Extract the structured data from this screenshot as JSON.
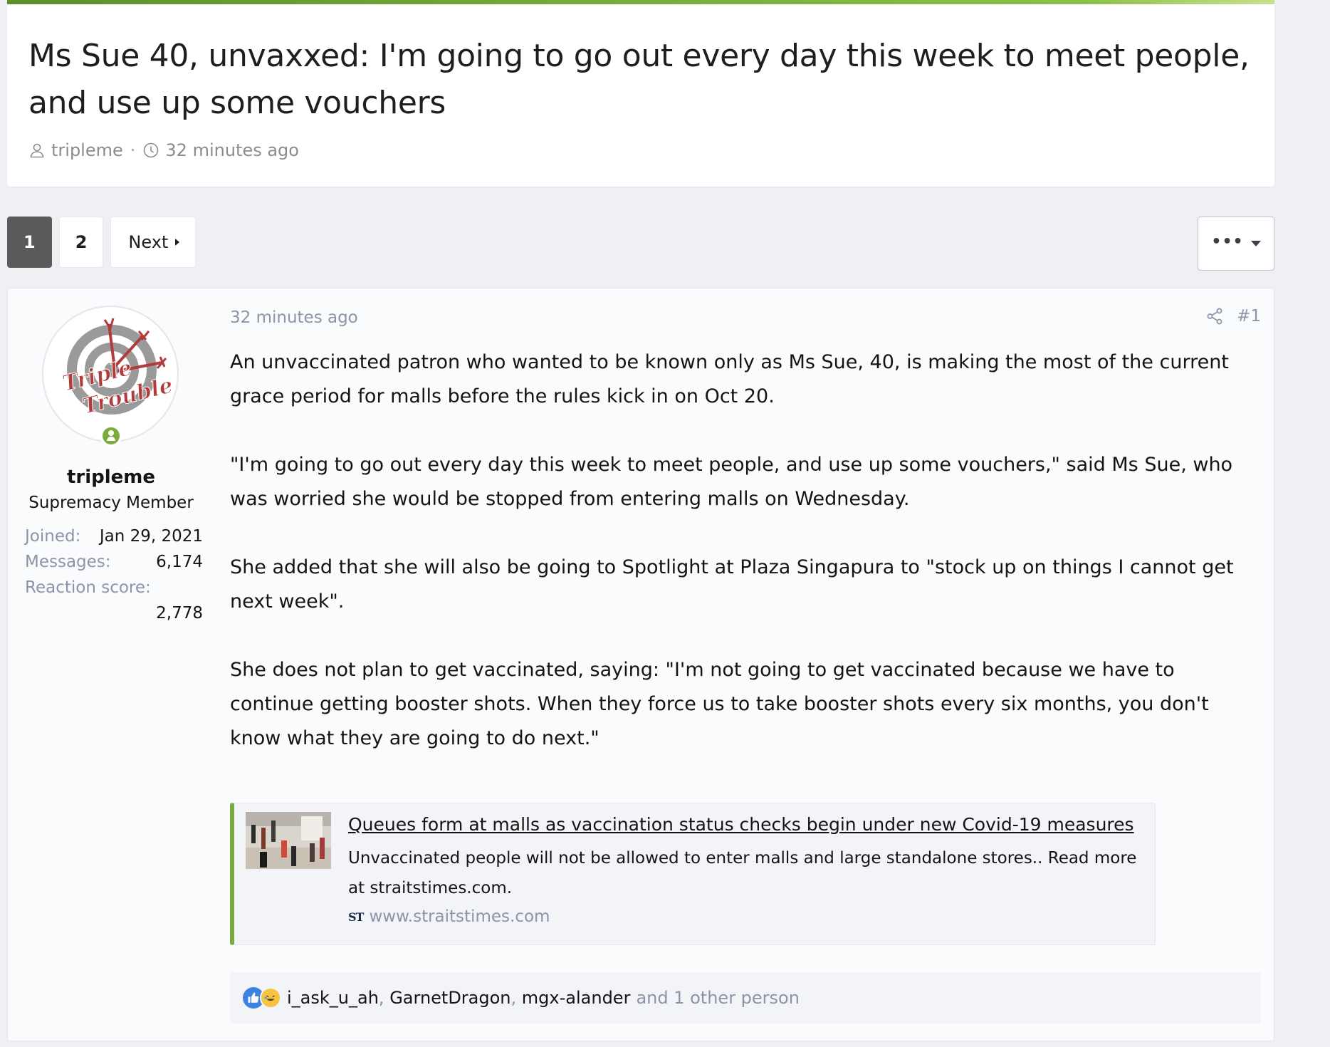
{
  "thread": {
    "title": "Ms Sue 40, unvaxxed: I'm going to go out every day this week to meet people, and use up some vouchers",
    "author": "tripleme",
    "time": "32 minutes ago",
    "meta_separator": "·"
  },
  "pagination": {
    "pages": [
      "1",
      "2"
    ],
    "active_page": "1",
    "next_label": "Next",
    "more_label": "•••"
  },
  "post": {
    "date": "32 minutes ago",
    "number": "#1",
    "paragraphs": [
      "An unvaccinated patron who wanted to be known only as Ms Sue, 40, is making the most of the current grace period for malls before the rules kick in on Oct 20.",
      "\"I'm going to go out every day this week to meet people, and use up some vouchers,\" said Ms Sue, who was worried she would be stopped from entering malls on Wednesday.",
      "She added that she will also be going to Spotlight at Plaza Singapura to \"stock up on things I cannot get next week\".",
      "She does not plan to get vaccinated, saying: \"I'm not going to get vaccinated because we have to continue getting booster shots. When they force us to take booster shots every six months, you don't know what they are going to do next.\""
    ],
    "unfurl": {
      "title": "Queues form at malls as vaccination status checks begin under new Covid-19 measures",
      "description": "Unvaccinated people will not be allowed to enter malls and large standalone stores.. Read more at straitstimes.com.",
      "site_mark": "ST",
      "site": "www.straitstimes.com"
    },
    "reactions": {
      "users": [
        "i_ask_u_ah",
        "GarnetDragon",
        "mgx-alander"
      ],
      "separator": ",",
      "other": "and 1 other person",
      "colors": {
        "like": "#3d82e0",
        "haha": "#f5c542"
      }
    }
  },
  "user": {
    "name": "tripleme",
    "title": "Supremacy Member",
    "avatar_text": [
      "Triple",
      "Trouble"
    ],
    "stats": [
      {
        "label": "Joined:",
        "value": "Jan 29, 2021"
      },
      {
        "label": "Messages:",
        "value": "6,174"
      },
      {
        "label": "Reaction score:",
        "value": "2,778"
      }
    ]
  },
  "colors": {
    "accent": "#7bab3f",
    "muted": "#8a95a8",
    "active_page_bg": "#5a5a5a"
  }
}
